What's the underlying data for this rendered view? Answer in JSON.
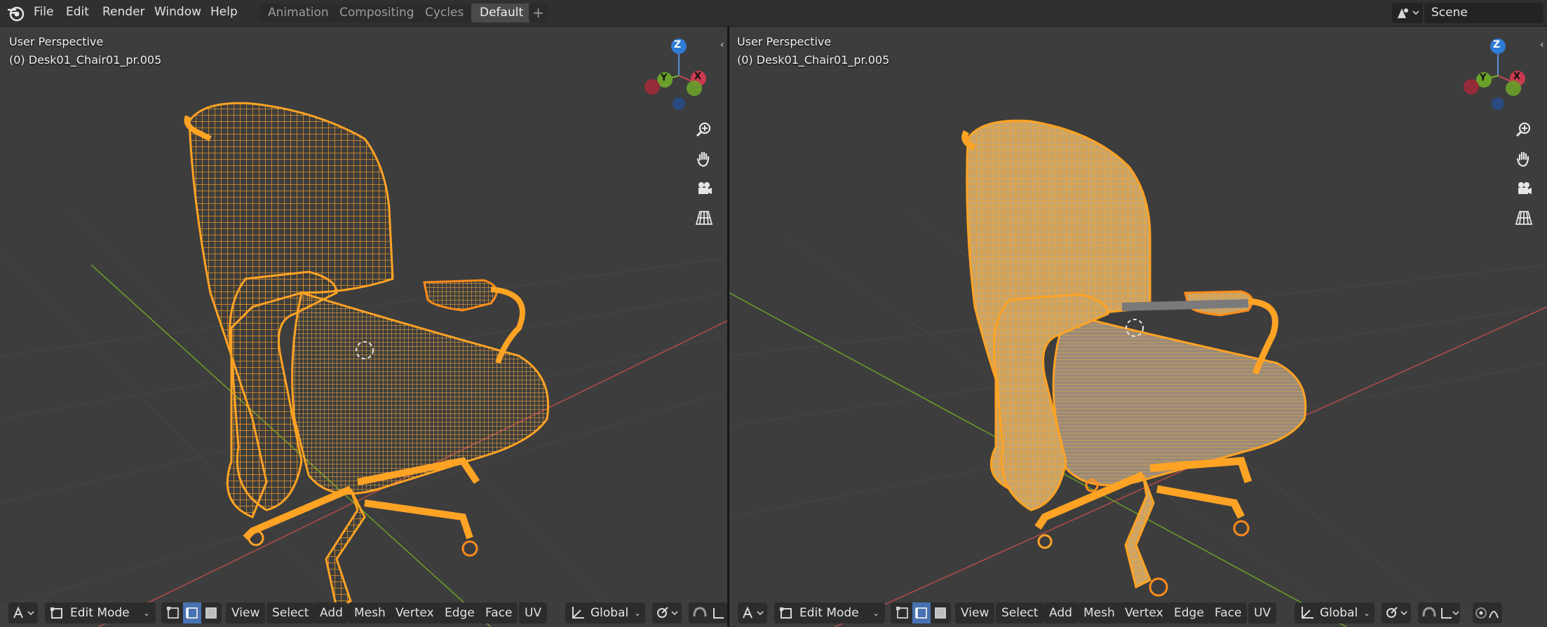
{
  "menubar": {
    "items": [
      "File",
      "Edit",
      "Render",
      "Window",
      "Help"
    ],
    "workspace_tabs": [
      "Animation",
      "Compositing",
      "Cycles",
      "Default"
    ],
    "active_tab": "Default",
    "add_tab_label": "+",
    "scene_label": "Scene"
  },
  "viewports": [
    {
      "view_name": "User Perspective",
      "object_name": "(0) Desk01_Chair01_pr.005",
      "shading": "wireframe",
      "gizmo": {
        "z": "Z",
        "y": "Y",
        "x": "X"
      },
      "header": {
        "mode": "Edit Mode",
        "menus": [
          "View",
          "Select",
          "Add",
          "Mesh",
          "Vertex",
          "Edge",
          "Face",
          "UV"
        ],
        "orientation": "Global",
        "active_select_mode": "edge"
      }
    },
    {
      "view_name": "User Perspective",
      "object_name": "(0) Desk01_Chair01_pr.005",
      "shading": "solid",
      "gizmo": {
        "z": "Z",
        "y": "Y",
        "x": "X"
      },
      "header": {
        "mode": "Edit Mode",
        "menus": [
          "View",
          "Select",
          "Add",
          "Mesh",
          "Vertex",
          "Edge",
          "Face",
          "UV"
        ],
        "orientation": "Global",
        "active_select_mode": "edge"
      }
    }
  ],
  "colors": {
    "selection": "#ffa324",
    "selection_edge": "#ff8c1a",
    "grid_x_axis": "#b04a4a",
    "grid_y_axis": "#6a9a2a",
    "viewport_bg": "#3d3d3d",
    "select_mode_active": "#4772b3"
  }
}
